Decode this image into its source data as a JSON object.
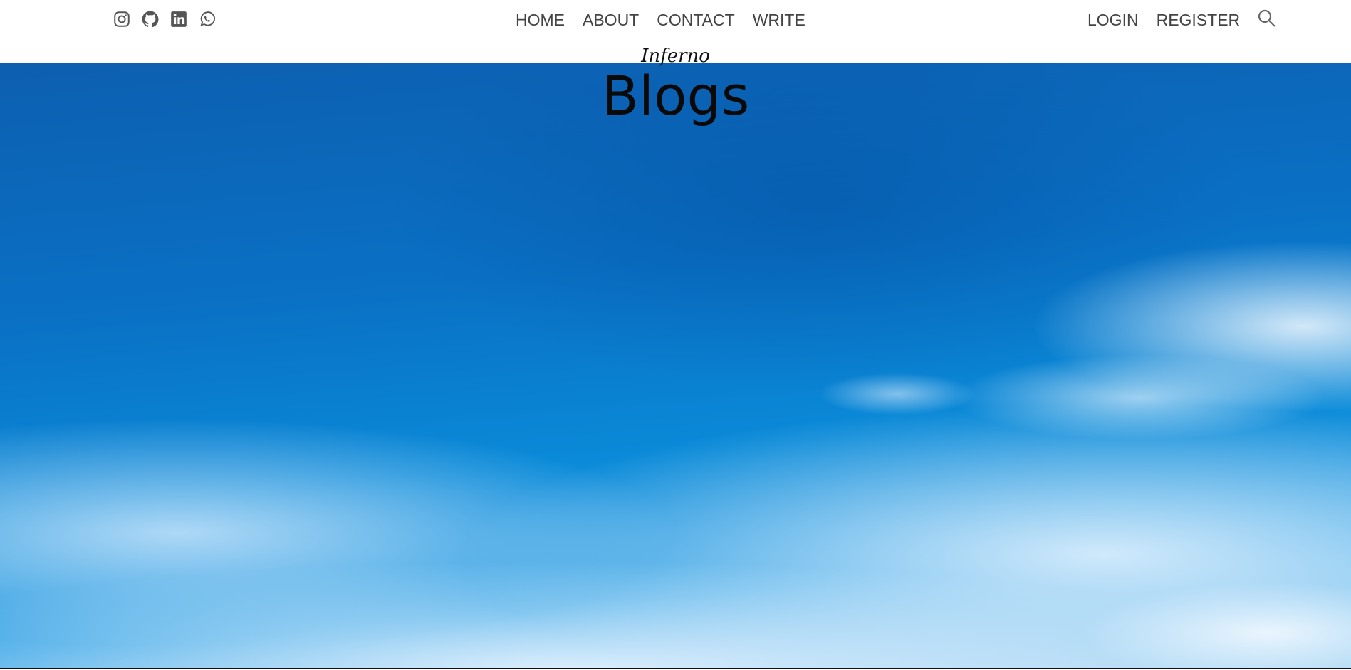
{
  "header": {
    "social_icons": [
      "instagram-icon",
      "github-icon",
      "linkedin-icon",
      "whatsapp-icon"
    ],
    "nav": {
      "home": "HOME",
      "about": "ABOUT",
      "contact": "CONTACT",
      "write": "WRITE"
    },
    "auth": {
      "login": "LOGIN",
      "register": "REGISTER"
    },
    "search_icon": "search-icon"
  },
  "hero": {
    "subtitle": "Inferno",
    "title": "Blogs",
    "background": "blue-sky-with-clouds"
  },
  "colors": {
    "nav_text": "#444444",
    "icon": "#555555",
    "sky_top": "#0d5fb0",
    "sky_bottom": "#a8d6f3"
  }
}
